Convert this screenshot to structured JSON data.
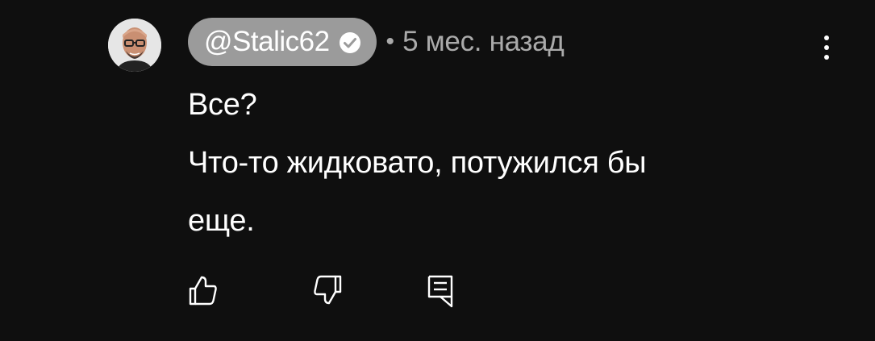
{
  "comment": {
    "author": "@Stalic62",
    "verified": true,
    "separator": "•",
    "timestamp": "5 мес. назад",
    "text_lines": [
      "Все?",
      "Что-то жидковато, потужился бы",
      "еще."
    ]
  },
  "icons": {
    "avatar": "avatar-photo",
    "verified": "checkmark-circle-icon",
    "menu": "more-vertical-icon",
    "like": "thumb-up-icon",
    "dislike": "thumb-down-icon",
    "reply": "reply-comment-icon"
  },
  "colors": {
    "background": "#0f0f0f",
    "author_chip": "#9b9b9b",
    "secondary_text": "#aaaaaa",
    "primary_text": "#ffffff"
  }
}
